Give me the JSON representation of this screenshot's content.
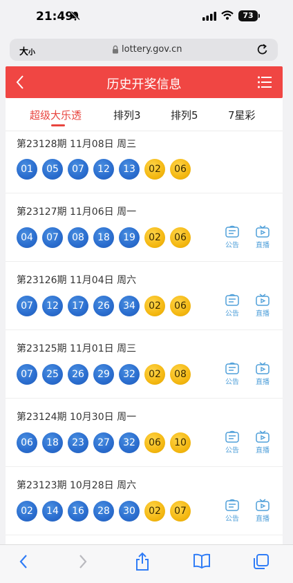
{
  "status": {
    "time": "21:49",
    "battery": "73"
  },
  "browser": {
    "text_size": "大",
    "text_size_small": "小",
    "url": "lottery.gov.cn"
  },
  "header": {
    "title": "历史开奖信息"
  },
  "tabs": [
    {
      "label": "超级大乐透",
      "active": true
    },
    {
      "label": "排列3",
      "active": false
    },
    {
      "label": "排列5",
      "active": false
    },
    {
      "label": "7星彩",
      "active": false
    }
  ],
  "records": [
    {
      "title": "第23128期  11月08日  周三",
      "front": [
        "01",
        "05",
        "07",
        "12",
        "13"
      ],
      "back": [
        "02",
        "06"
      ],
      "actions": false
    },
    {
      "title": "第23127期  11月06日  周一",
      "front": [
        "04",
        "07",
        "08",
        "18",
        "19"
      ],
      "back": [
        "02",
        "06"
      ],
      "actions": true
    },
    {
      "title": "第23126期  11月04日  周六",
      "front": [
        "07",
        "12",
        "17",
        "26",
        "34"
      ],
      "back": [
        "02",
        "06"
      ],
      "actions": true
    },
    {
      "title": "第23125期  11月01日  周三",
      "front": [
        "07",
        "25",
        "26",
        "29",
        "32"
      ],
      "back": [
        "02",
        "08"
      ],
      "actions": true
    },
    {
      "title": "第23124期  10月30日  周一",
      "front": [
        "06",
        "18",
        "23",
        "27",
        "32"
      ],
      "back": [
        "06",
        "10"
      ],
      "actions": true
    },
    {
      "title": "第23123期  10月28日  周六",
      "front": [
        "02",
        "14",
        "16",
        "28",
        "30"
      ],
      "back": [
        "02",
        "07"
      ],
      "actions": true
    }
  ],
  "actions": {
    "notice": "公告",
    "live": "直播"
  },
  "colors": {
    "header": "#f04643",
    "front_ball": "#2c6fd0",
    "back_ball": "#f4b812",
    "accent": "#e8443e",
    "action": "#4f9fd9"
  },
  "icons": [
    "bell-slash-icon",
    "signal-icon",
    "wifi-icon",
    "lock-icon",
    "reload-icon",
    "back-icon",
    "menu-icon",
    "notice-icon",
    "live-tv-icon",
    "share-icon",
    "bookmarks-icon",
    "tabs-icon"
  ]
}
